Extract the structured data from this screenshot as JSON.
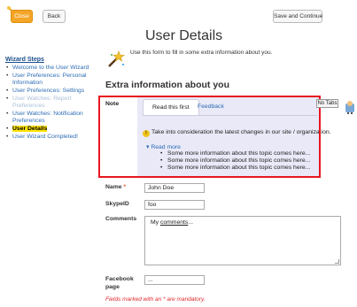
{
  "toolbar": {
    "close_label": "Close",
    "back_label": "Back",
    "save_label": "Save and Continue"
  },
  "sidebar": {
    "title": "Wizard Steps",
    "items": [
      {
        "label": "Welcome to the User Wizard",
        "state": "link"
      },
      {
        "label": "User Preferences: Personal Information",
        "state": "link"
      },
      {
        "label": "User Preferences: Settings",
        "state": "link"
      },
      {
        "label": "User Watches: Report Preferences",
        "state": "disabled"
      },
      {
        "label": "User Watches: Notification Preferences",
        "state": "link"
      },
      {
        "label": "User Details",
        "state": "current"
      },
      {
        "label": "User Wizard Completed!",
        "state": "link"
      }
    ]
  },
  "header": {
    "title": "User Details",
    "intro": "Use this form to fill in some extra information about you.",
    "section": "Extra information about you"
  },
  "note": {
    "label": "Note",
    "tabs": [
      {
        "label": "Read this first"
      },
      {
        "label": "Feedback"
      }
    ],
    "no_tabs_label": "No Tabs",
    "message": "Take into consideration the latest changes in our site / organization.",
    "read_more_label": "Read more",
    "read_more_items": [
      "Some more information about this topic comes here...",
      "Some more information about this topic comes here...",
      "Some more information about this topic comes here..."
    ]
  },
  "form": {
    "name": {
      "label": "Name",
      "required_mark": "*",
      "value": "John Doe"
    },
    "skype": {
      "label": "SkypeID",
      "value": "foo"
    },
    "comments": {
      "label": "Comments",
      "value_word": "My",
      "value_underlined": "comments",
      "value_tail": "..."
    },
    "facebook": {
      "label": "Facebook page",
      "value": "..."
    },
    "mandatory_note": "Fields marked with an * are mandatory."
  },
  "colors": {
    "accent_link": "#2c6bb5",
    "highlight": "#ffe400",
    "required": "#e0282e",
    "frame": "#e8171f",
    "close_button": "#f4a528"
  }
}
